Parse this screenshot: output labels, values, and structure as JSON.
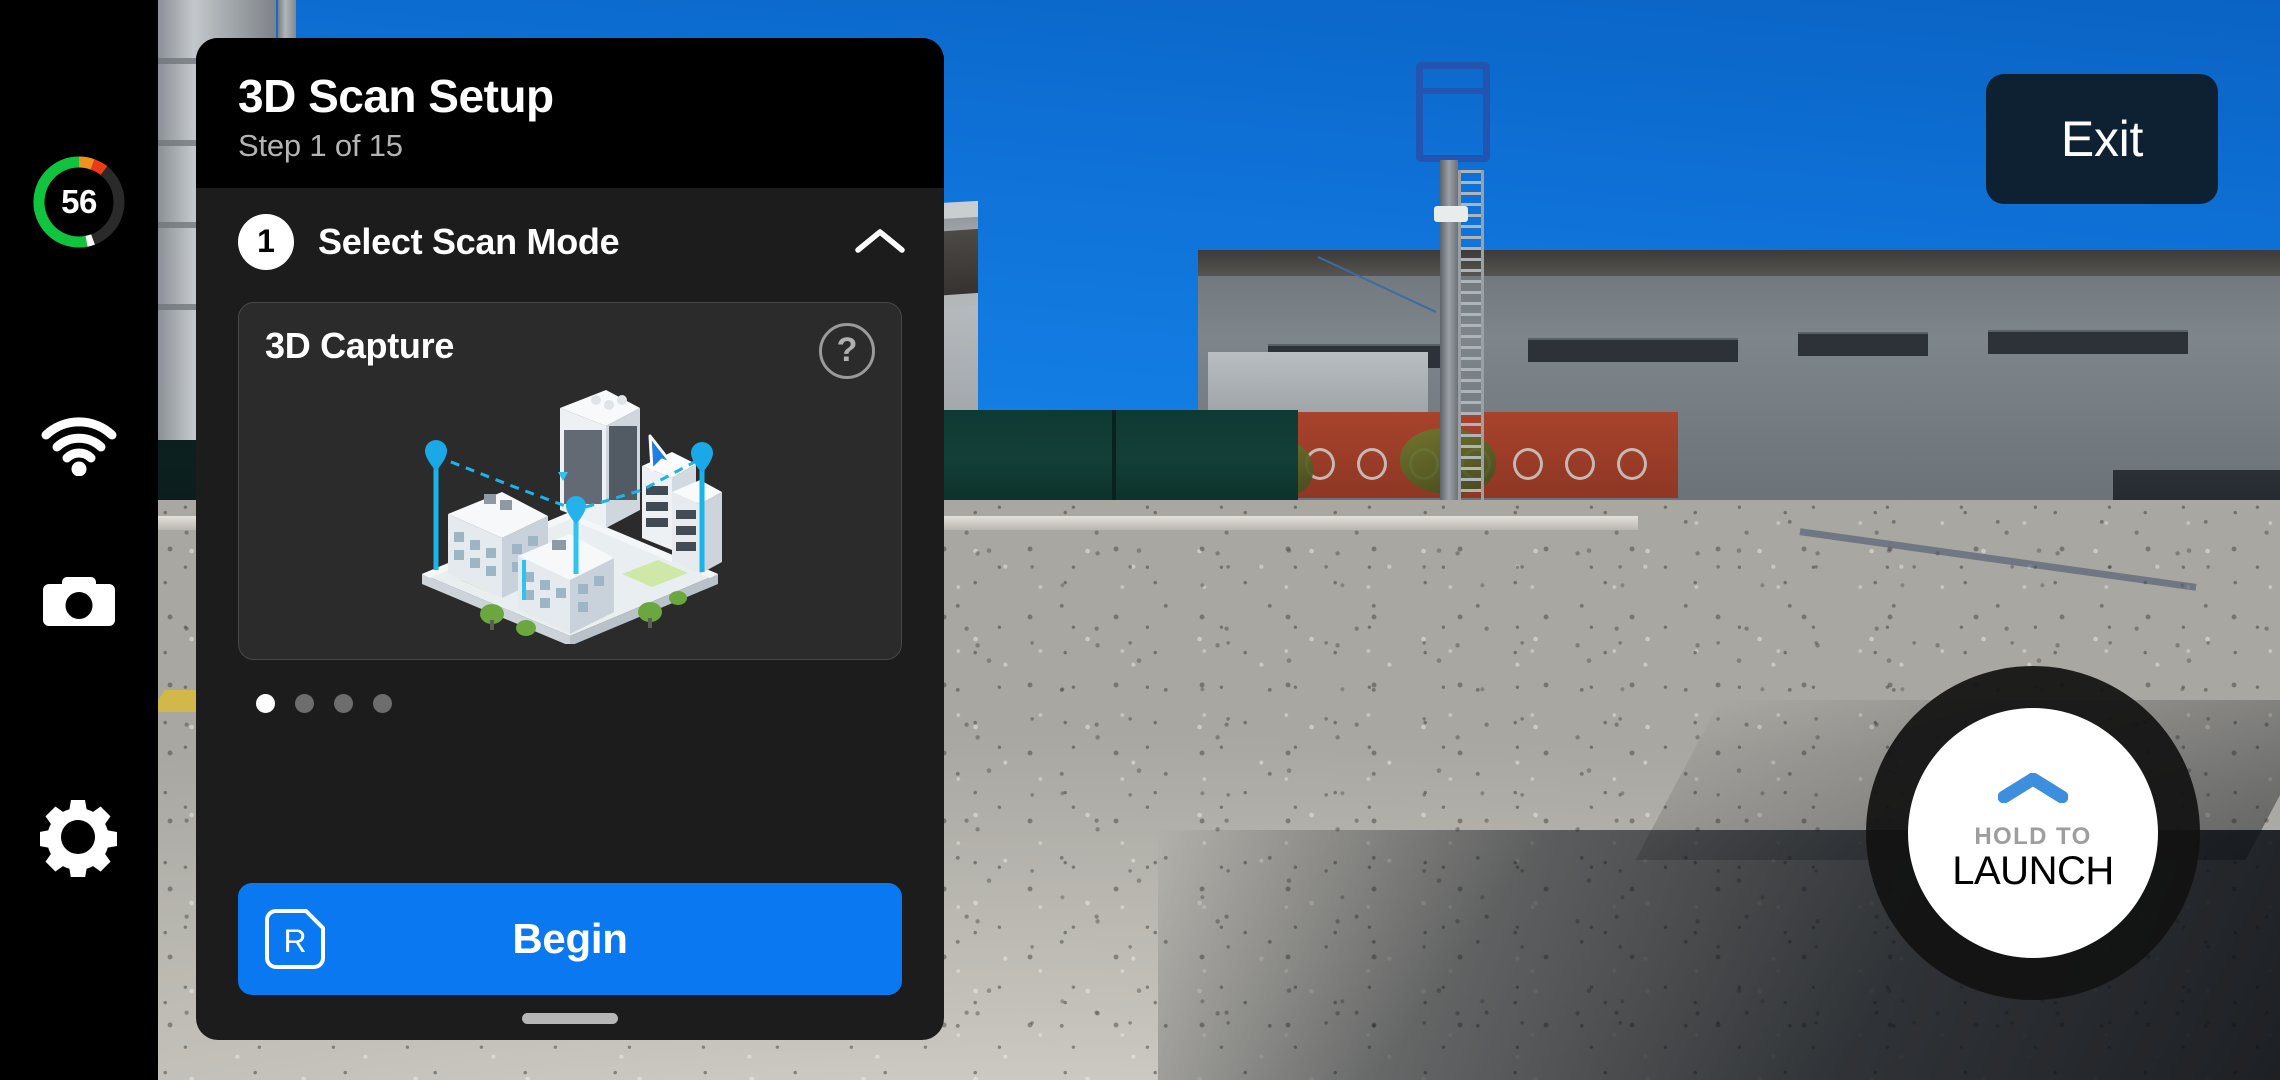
{
  "sidebar": {
    "battery": {
      "value": "56",
      "percent": 56,
      "green": "#10c43d",
      "orange": "#f0921e",
      "red": "#f03a17",
      "track": "#2a2a2a"
    },
    "items": [
      {
        "icon": "wifi-icon",
        "name": "wifi-status"
      },
      {
        "icon": "camera-icon",
        "name": "camera-button"
      },
      {
        "icon": "gear-icon",
        "name": "settings-button"
      }
    ]
  },
  "panel": {
    "title": "3D Scan Setup",
    "subtitle": "Step 1 of 15",
    "step": {
      "number": "1",
      "label": "Select Scan Mode",
      "collapse_icon": "chevron-up-icon"
    },
    "mode_card": {
      "title": "3D Capture",
      "help_icon": "question-mark-icon",
      "illustration": "isometric-city-3d-scan"
    },
    "pagination": {
      "count": 4,
      "active_index": 0
    },
    "begin_button": {
      "label": "Begin",
      "shortcut": "R",
      "color": "#0a78f0"
    },
    "drag_handle": "panel-drag-handle"
  },
  "exit_button": {
    "label": "Exit"
  },
  "launch_button": {
    "sub_label": "HOLD TO",
    "main_label": "LAUNCH",
    "chevron_icon": "chevron-up-icon",
    "accent": "#3d8fdd"
  }
}
